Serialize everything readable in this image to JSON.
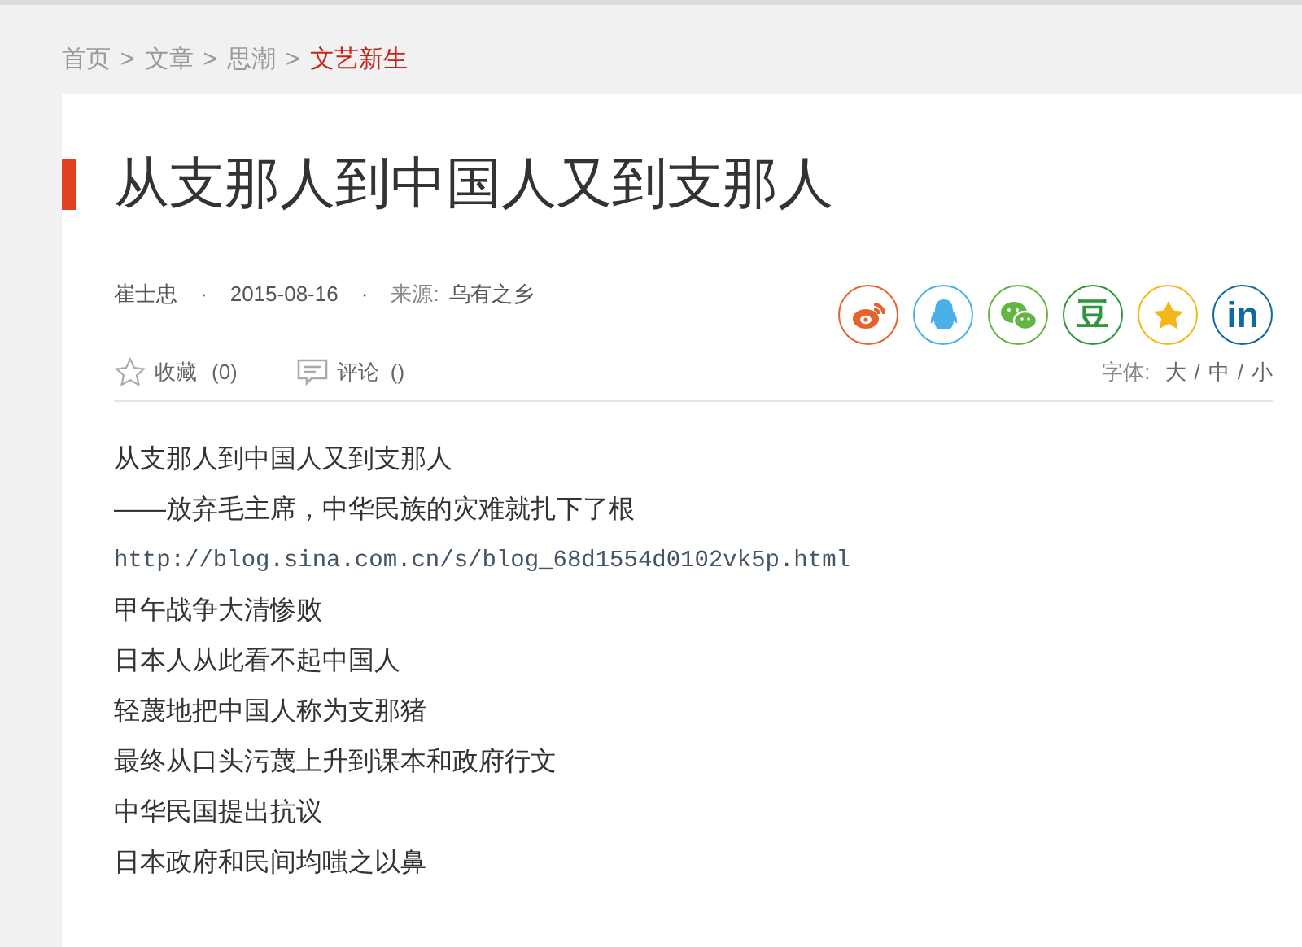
{
  "breadcrumb": [
    {
      "label": "首页",
      "current": false
    },
    {
      "label": "文章",
      "current": false
    },
    {
      "label": "思潮",
      "current": false
    },
    {
      "label": "文艺新生",
      "current": true
    }
  ],
  "breadcrumb_separator": ">",
  "article": {
    "title": "从支那人到中国人又到支那人",
    "author": "崔士忠",
    "date": "2015-08-16",
    "separator": "·",
    "source_label": "来源:",
    "source": "乌有之乡",
    "share": [
      {
        "kind": "weibo",
        "color": "#e8632c"
      },
      {
        "kind": "qq",
        "color": "#4ab1e8"
      },
      {
        "kind": "wechat",
        "color": "#62b543"
      },
      {
        "kind": "douban",
        "color": "#2e963d",
        "glyph": "豆"
      },
      {
        "kind": "qzone",
        "color": "#f5b81c"
      },
      {
        "kind": "linkedin",
        "color": "#0e6aa0",
        "glyph": "in"
      }
    ],
    "favorite": {
      "label": "收藏",
      "count": "(0)"
    },
    "comment": {
      "label": "评论",
      "count": "()"
    },
    "font_size": {
      "label": "字体:",
      "options": [
        "大",
        "中",
        "小"
      ],
      "separator": "/"
    },
    "body": [
      {
        "kind": "text",
        "text": "从支那人到中国人又到支那人"
      },
      {
        "kind": "text",
        "text": "——放弃毛主席，中华民族的灾难就扎下了根"
      },
      {
        "kind": "url",
        "text": "http://blog.sina.com.cn/s/blog_68d1554d0102vk5p.html"
      },
      {
        "kind": "text",
        "text": "甲午战争大清惨败"
      },
      {
        "kind": "text",
        "text": "日本人从此看不起中国人"
      },
      {
        "kind": "text",
        "text": "轻蔑地把中国人称为支那猪"
      },
      {
        "kind": "text",
        "text": "最终从口头污蔑上升到课本和政府行文"
      },
      {
        "kind": "text",
        "text": "中华民国提出抗议"
      },
      {
        "kind": "text",
        "text": "日本政府和民间均嗤之以鼻"
      }
    ]
  }
}
